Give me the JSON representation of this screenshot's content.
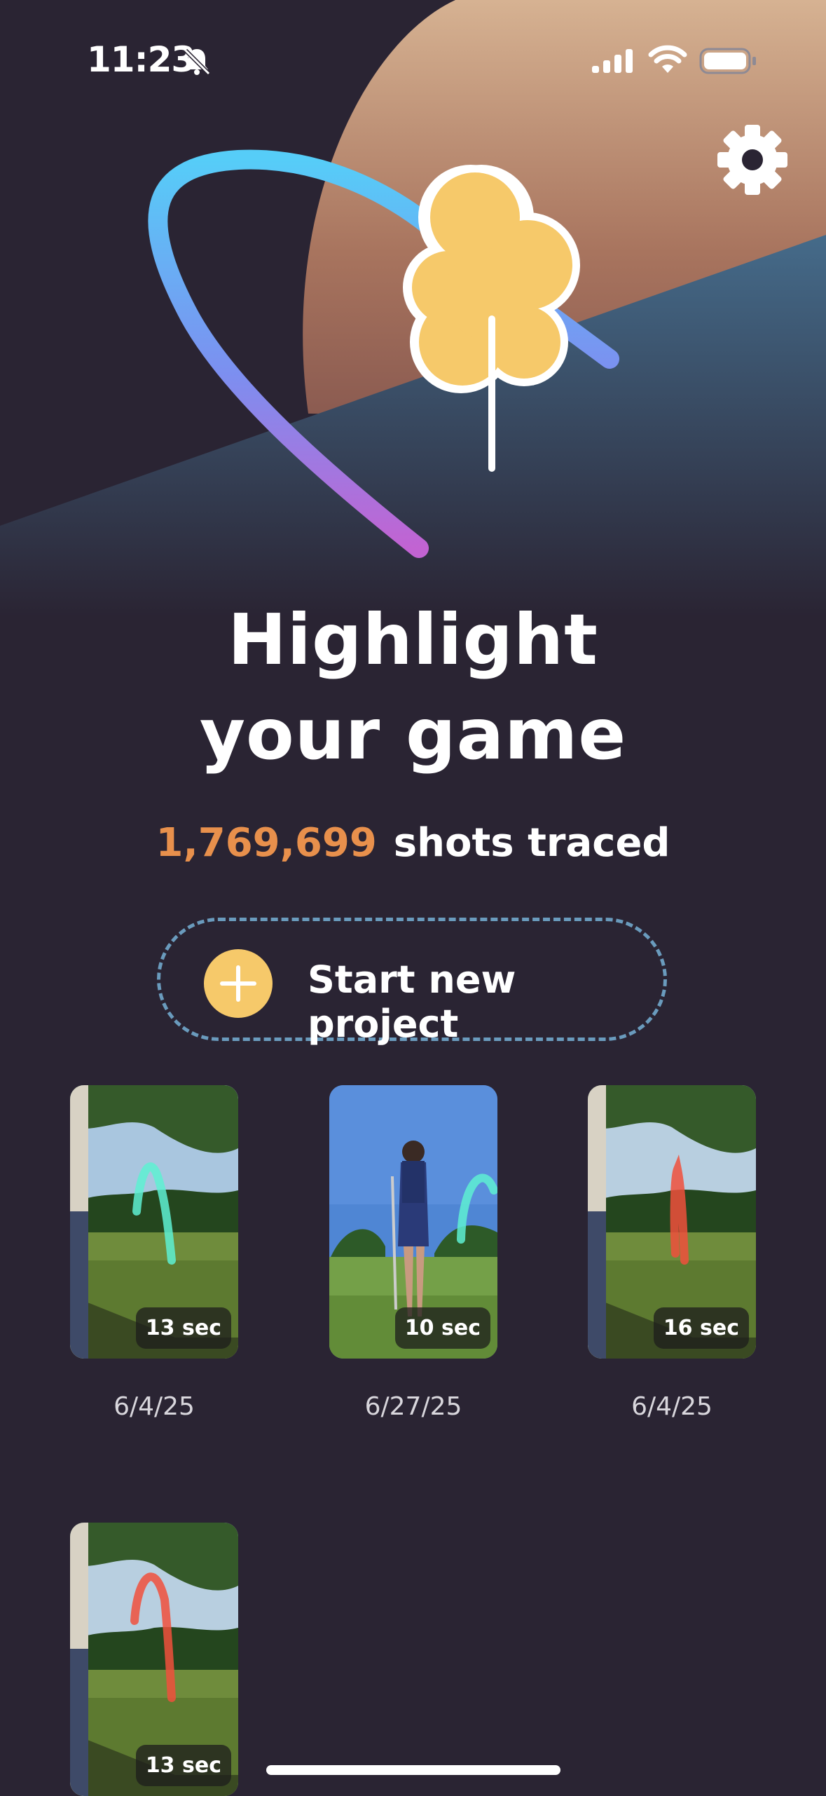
{
  "status_bar": {
    "time": "11:23",
    "icons": [
      "bell-slash-icon",
      "cellular-signal-icon",
      "wifi-icon",
      "battery-icon"
    ]
  },
  "header": {
    "settings_icon": "gear-icon"
  },
  "hero": {
    "title_line1": "Highlight",
    "title_line2": "your game",
    "shots_count": "1,769,699",
    "shots_label": "shots traced"
  },
  "new_project": {
    "label": "Start new project",
    "icon": "plus-icon"
  },
  "projects": [
    {
      "duration": "13 sec",
      "date": "6/4/25",
      "trace_color": "#5ef0d2"
    },
    {
      "duration": "10 sec",
      "date": "6/27/25",
      "trace_color": "#5ef0d2"
    },
    {
      "duration": "16 sec",
      "date": "6/4/25",
      "trace_color": "#f0503c"
    },
    {
      "duration": "13 sec",
      "date": "",
      "trace_color": "#f0503c"
    }
  ],
  "colors": {
    "background": "#2a2433",
    "accent_orange": "#e8904c",
    "accent_yellow": "#f6c96a",
    "dashed_border": "#6a9bbd"
  }
}
